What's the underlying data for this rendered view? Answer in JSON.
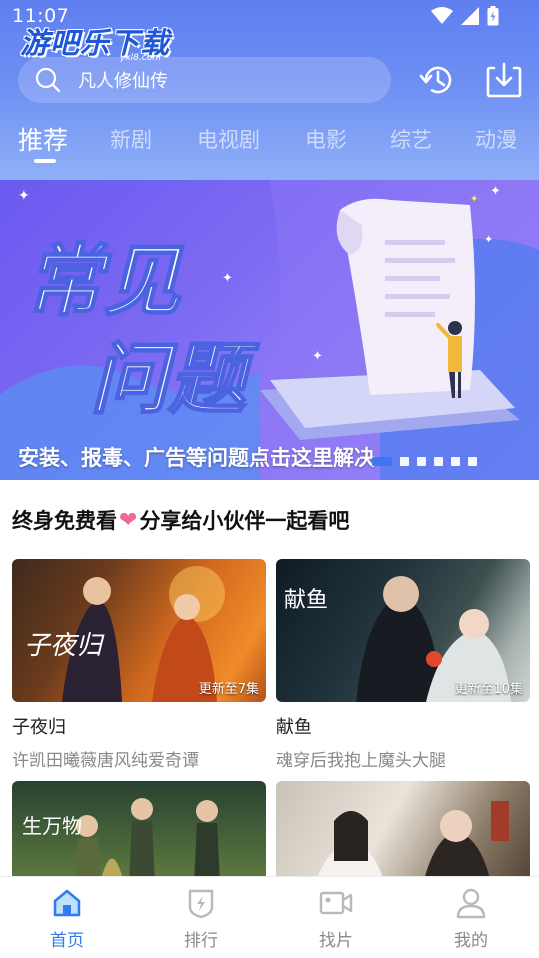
{
  "status": {
    "time": "11:07"
  },
  "watermark": {
    "text": "游吧乐下载",
    "sub": "yxl8.com"
  },
  "search": {
    "placeholder": "凡人修仙传"
  },
  "tabs": [
    {
      "label": "推荐",
      "active": true
    },
    {
      "label": "新剧"
    },
    {
      "label": "电视剧"
    },
    {
      "label": "电影"
    },
    {
      "label": "综艺"
    },
    {
      "label": "动漫"
    }
  ],
  "banner": {
    "title_line1": "常见",
    "title_line2": "问题",
    "caption": "安装、报毒、广告等问题点击这里解决",
    "dot_count": 6,
    "active_dot": 0
  },
  "section": {
    "title_left": "终身免费看",
    "title_right": "分享给小伙伴一起看吧",
    "heart_icon": "heart-icon"
  },
  "cards": [
    {
      "poster_text": "子夜归",
      "badge": "更新至7集",
      "title": "子夜归",
      "subtitle": "许凯田曦薇唐风纯爱奇谭"
    },
    {
      "poster_text": "献鱼",
      "badge": "更新至10集",
      "title": "献鱼",
      "subtitle": "魂穿后我抱上魔头大腿"
    },
    {
      "poster_text": "生万物",
      "badge": "",
      "title": "",
      "subtitle": ""
    },
    {
      "poster_text": "",
      "badge": "",
      "title": "",
      "subtitle": ""
    }
  ],
  "tabbar": [
    {
      "label": "首页",
      "icon": "home-icon",
      "active": true
    },
    {
      "label": "排行",
      "icon": "ranking-icon"
    },
    {
      "label": "找片",
      "icon": "video-camera-icon"
    },
    {
      "label": "我的",
      "icon": "user-icon"
    }
  ],
  "colors": {
    "accent": "#2f7cf2",
    "header": "#6d8ef3",
    "banner": "#7d6bf3",
    "heart": "#f06b94"
  }
}
